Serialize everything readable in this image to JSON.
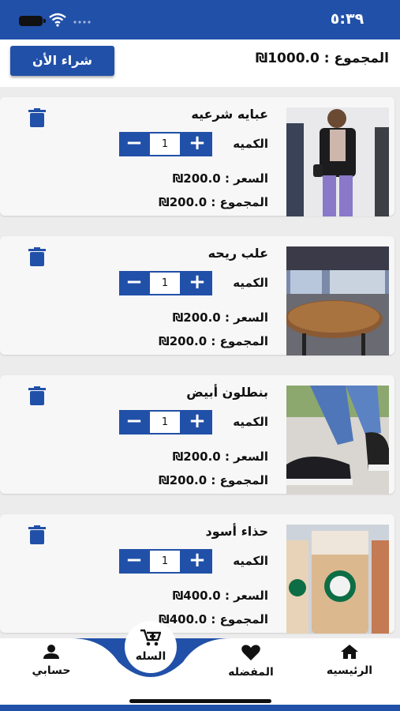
{
  "status_bar": {
    "time": "٥:٣٩"
  },
  "header": {
    "total_text": "المجموع : 1000.0₪",
    "buy_label": "شراء الأن"
  },
  "cart": {
    "quantity_label": "الكميه",
    "items": [
      {
        "name": "عبايه شرعيه",
        "quantity": "1",
        "price_text": "السعر : 200.0₪",
        "subtotal_text": "المجموع : 200.0₪",
        "image": "woman-in-black-jacket"
      },
      {
        "name": "علب ريحه",
        "quantity": "1",
        "price_text": "السعر : 200.0₪",
        "subtotal_text": "المجموع : 200.0₪",
        "image": "restaurant-wooden-table"
      },
      {
        "name": "بنطلون أبيض",
        "quantity": "1",
        "price_text": "السعر : 200.0₪",
        "subtotal_text": "المجموع : 200.0₪",
        "image": "sneakers-and-jeans"
      },
      {
        "name": "حذاء أسود",
        "quantity": "1",
        "price_text": "السعر : 400.0₪",
        "subtotal_text": "المجموع : 400.0₪",
        "image": "starbucks-iced-coffee"
      }
    ]
  },
  "bottom_nav": {
    "home_label": "الرئيسيه",
    "favorites_label": "المفضله",
    "cart_label": "السله",
    "account_label": "حسابي"
  },
  "colors": {
    "primary": "#2150a8",
    "background": "#ececec",
    "card": "#f7f7f7"
  },
  "icons": [
    "battery-icon",
    "wifi-icon",
    "signal-icon",
    "trash-icon",
    "minus-icon",
    "plus-icon",
    "home-icon",
    "heart-icon",
    "cart-icon",
    "person-icon"
  ]
}
